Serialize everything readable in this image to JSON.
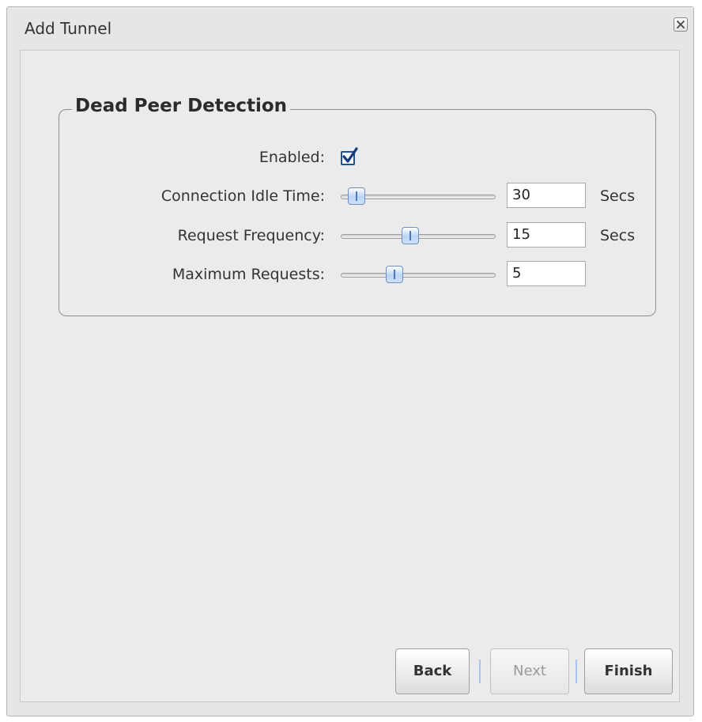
{
  "window": {
    "title": "Add Tunnel"
  },
  "section": {
    "legend": "Dead Peer Detection"
  },
  "fields": {
    "enabled": {
      "label": "Enabled:",
      "checked": true
    },
    "connection_idle_time": {
      "label": "Connection Idle Time:",
      "value": "30",
      "unit": "Secs",
      "slider_fraction": 0.05
    },
    "request_frequency": {
      "label": "Request Frequency:",
      "value": "15",
      "unit": "Secs",
      "slider_fraction": 0.44
    },
    "maximum_requests": {
      "label": "Maximum Requests:",
      "value": "5",
      "unit": "",
      "slider_fraction": 0.33
    }
  },
  "buttons": {
    "back": "Back",
    "next": "Next",
    "finish": "Finish"
  },
  "colors": {
    "dialog_background": "#e6e6e6",
    "accent_blue": "#1f4f9e",
    "slider_handle": "#b8d4f5"
  },
  "icons": {
    "close": "close-icon",
    "checkbox": "checkmark-icon"
  }
}
